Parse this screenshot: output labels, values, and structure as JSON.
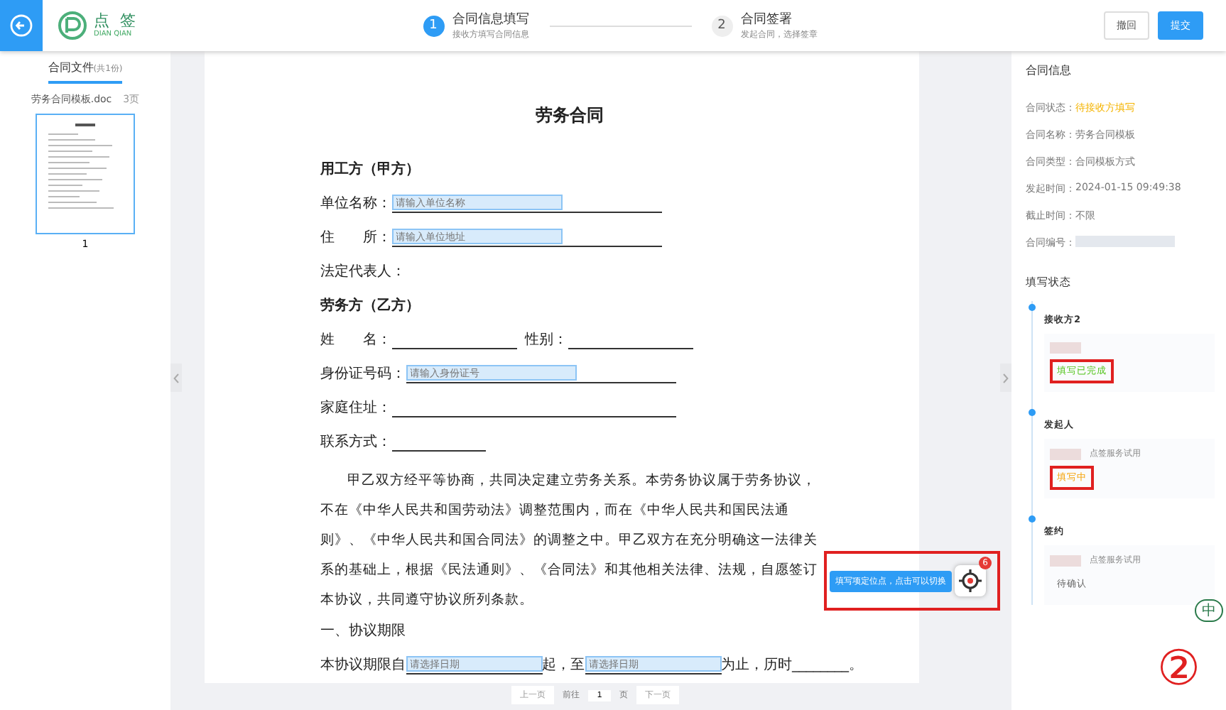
{
  "header": {
    "logo_text": "点 签",
    "logo_sub": "DIAN QIAN",
    "steps": [
      {
        "number": "1",
        "title": "合同信息填写",
        "subtitle": "接收方填写合同信息",
        "selected": true
      },
      {
        "number": "2",
        "title": "合同签署",
        "subtitle": "发起合同，选择签章",
        "selected": false
      }
    ],
    "buttons": [
      {
        "label": "撤回",
        "kind": "plain"
      },
      {
        "label": "提交",
        "kind": "primary"
      }
    ]
  },
  "files": {
    "title": "合同文件",
    "count": "(共1份)",
    "file_name": "劳务合同模板.doc",
    "pages": "3页",
    "page_number": "1"
  },
  "document": {
    "title": "劳务合同",
    "lines": [
      {
        "kind": "heading",
        "text": "用工方（甲方）"
      },
      {
        "kind": "field",
        "label": "单位名称：",
        "placeholder": "请输入单位名称"
      },
      {
        "kind": "field",
        "label": "住　　所：",
        "placeholder": "请输入单位地址"
      },
      {
        "kind": "label",
        "text": "法定代表人："
      },
      {
        "kind": "heading",
        "text": "劳务方（乙方）"
      },
      {
        "kind": "pair",
        "label": "姓　　名：",
        "label2": "性别："
      },
      {
        "kind": "field",
        "label": "身份证号码：",
        "placeholder": "请输入身份证号"
      },
      {
        "kind": "blank",
        "label": "家庭住址："
      },
      {
        "kind": "short",
        "label": "联系方式："
      },
      {
        "kind": "paragraph",
        "text": "甲乙双方经平等协商，共同决定建立劳务关系。本劳务协议属于劳务协议，不在《中华人民共和国劳动法》调整范围内，而在《中华人民共和国民法通则》、《中华人民共和国合同法》的调整之中。甲乙双方在充分明确这一法律关系的基础上，根据《民法通则》、《合同法》和其他相关法律、法规，自愿签订本协议，共同遵守协议所列条款。"
      },
      {
        "kind": "label",
        "text": "一、协议期限"
      },
      {
        "kind": "dates",
        "before": "本协议期限自",
        "placeholder": "请选择日期",
        "middle": "起，至",
        "placeholder2": "请选择日期",
        "after": "为止，历时________。"
      }
    ],
    "locator": {
      "tip": "填写项定位点，点击可以切换",
      "badge": "6"
    },
    "pager": {
      "prev": "上一页",
      "goto": "前往",
      "page": "1",
      "unit": "页",
      "next": "下一页"
    }
  },
  "info": {
    "title": "合同信息",
    "rows": [
      {
        "label": "合同状态：",
        "value": "待接收方填写",
        "kind": "status"
      },
      {
        "label": "合同名称：",
        "value": "劳务合同模板",
        "kind": "text"
      },
      {
        "label": "合同类型：",
        "value": "合同模板方式",
        "kind": "text"
      },
      {
        "label": "发起时间：",
        "value": "2024-01-15 09:49:38",
        "kind": "text"
      },
      {
        "label": "截止时间：",
        "value": "不限",
        "kind": "text"
      },
      {
        "label": "合同编号：",
        "kind": "hidden"
      }
    ],
    "fill_title": "填写状态",
    "parties": [
      {
        "name": "接收方2",
        "status": "填写已完成",
        "kind": "done"
      },
      {
        "name": "发起人",
        "note": "点签服务试用",
        "status": "填写中",
        "kind": "progress"
      },
      {
        "name": "签约",
        "note": "点签服务试用",
        "status": "待确认",
        "kind": "pending"
      }
    ]
  },
  "ime": "中",
  "annotation": "②"
}
